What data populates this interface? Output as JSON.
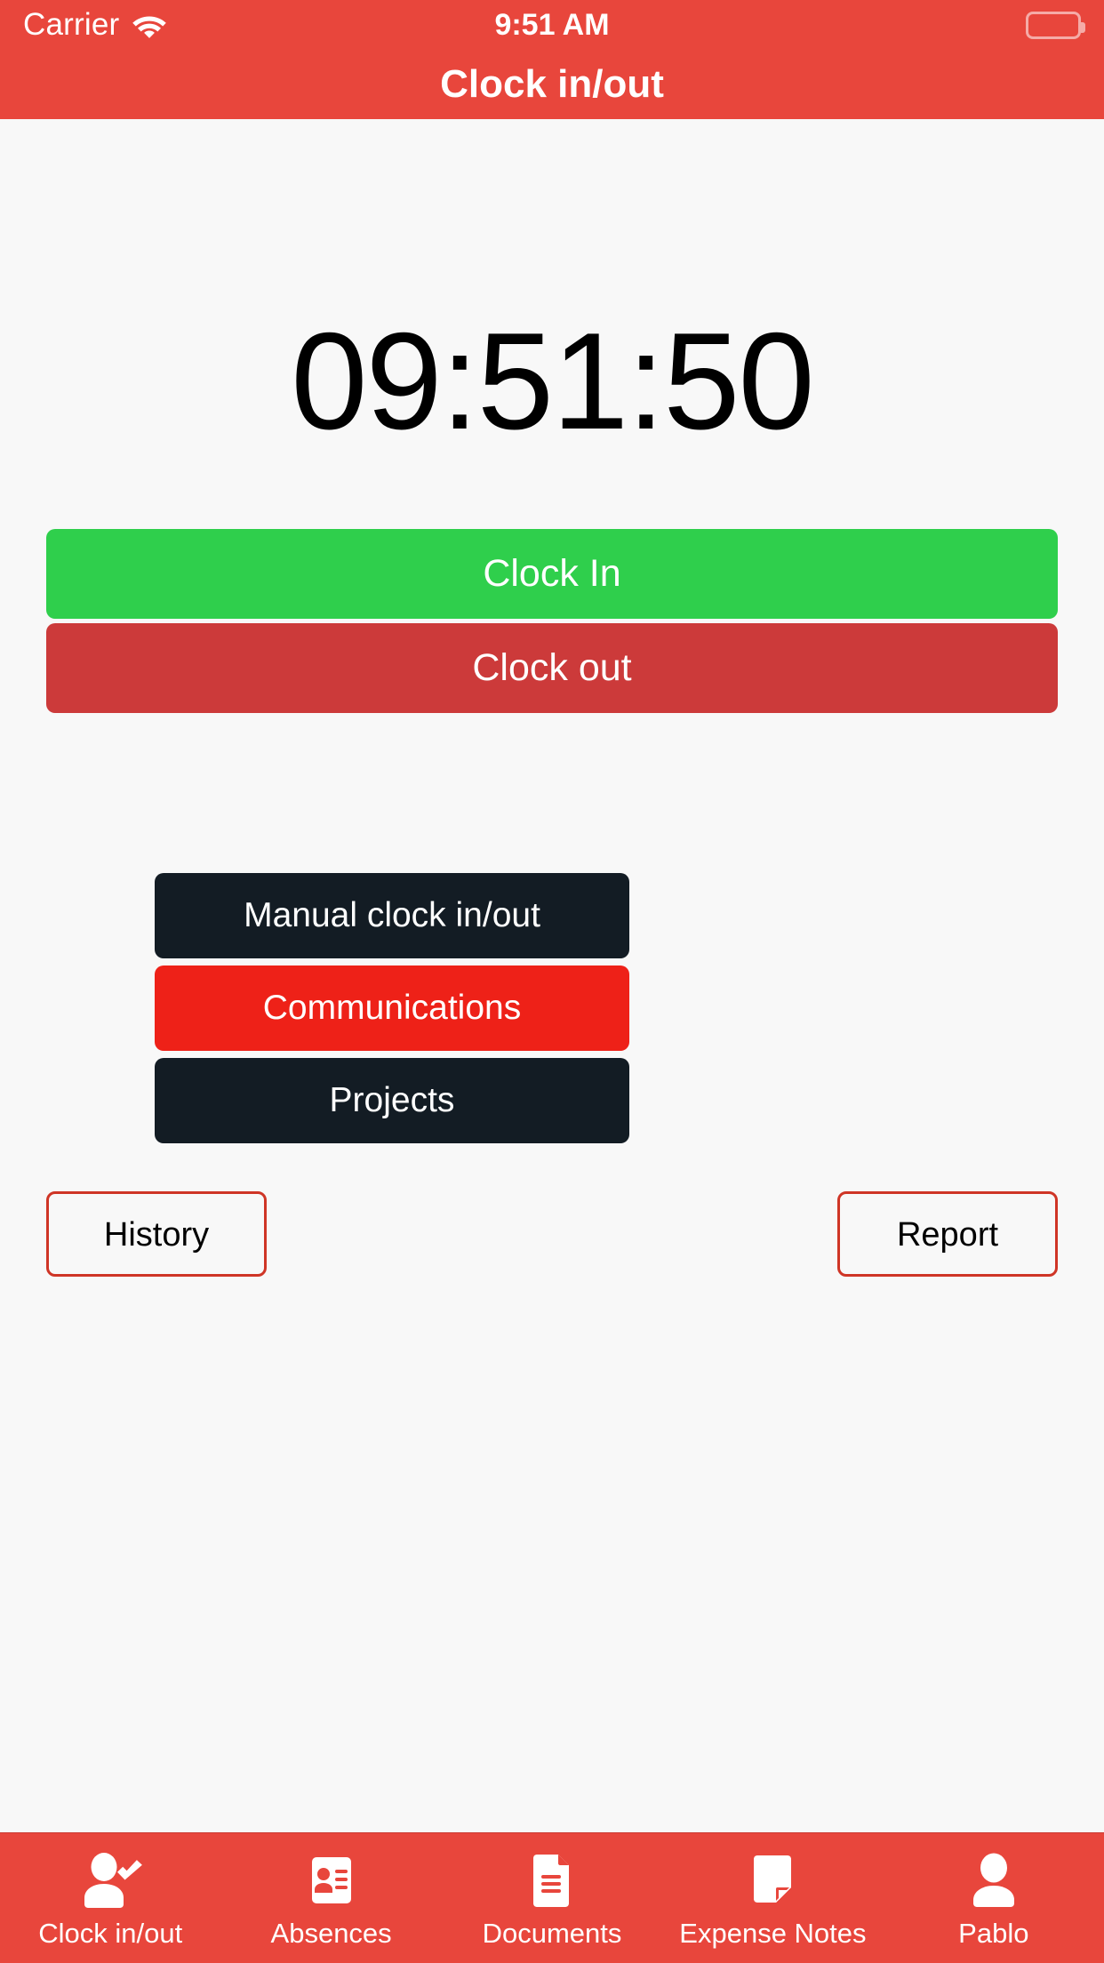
{
  "statusbar": {
    "carrier": "Carrier",
    "time": "9:51 AM",
    "wifi_icon": "wifi-icon",
    "battery_icon": "battery-full-icon"
  },
  "header": {
    "title": "Clock in/out",
    "background_color": "#e8463c"
  },
  "main": {
    "clock": "09:51:50",
    "primary_actions": [
      {
        "label": "Clock In",
        "color": "#2fcf4c"
      },
      {
        "label": "Clock out",
        "color": "#cc3a3a"
      }
    ],
    "secondary_actions": [
      {
        "label": "Manual clock in/out",
        "color": "#131c24"
      },
      {
        "label": "Communications",
        "color": "#ee2118"
      },
      {
        "label": "Projects",
        "color": "#131c24"
      }
    ],
    "outline_actions": [
      {
        "label": "History",
        "border_color": "#cf3526"
      },
      {
        "label": "Report",
        "border_color": "#cf3526"
      }
    ]
  },
  "tabbar": {
    "background_color": "#e8463c",
    "items": [
      {
        "label": "Clock in/out",
        "icon": "person-check-icon",
        "active": true
      },
      {
        "label": "Absences",
        "icon": "id-card-icon",
        "active": false
      },
      {
        "label": "Documents",
        "icon": "document-icon",
        "active": false
      },
      {
        "label": "Expense Notes",
        "icon": "note-folded-corner-icon",
        "active": false
      },
      {
        "label": "Pablo",
        "icon": "person-icon",
        "active": false
      }
    ]
  }
}
